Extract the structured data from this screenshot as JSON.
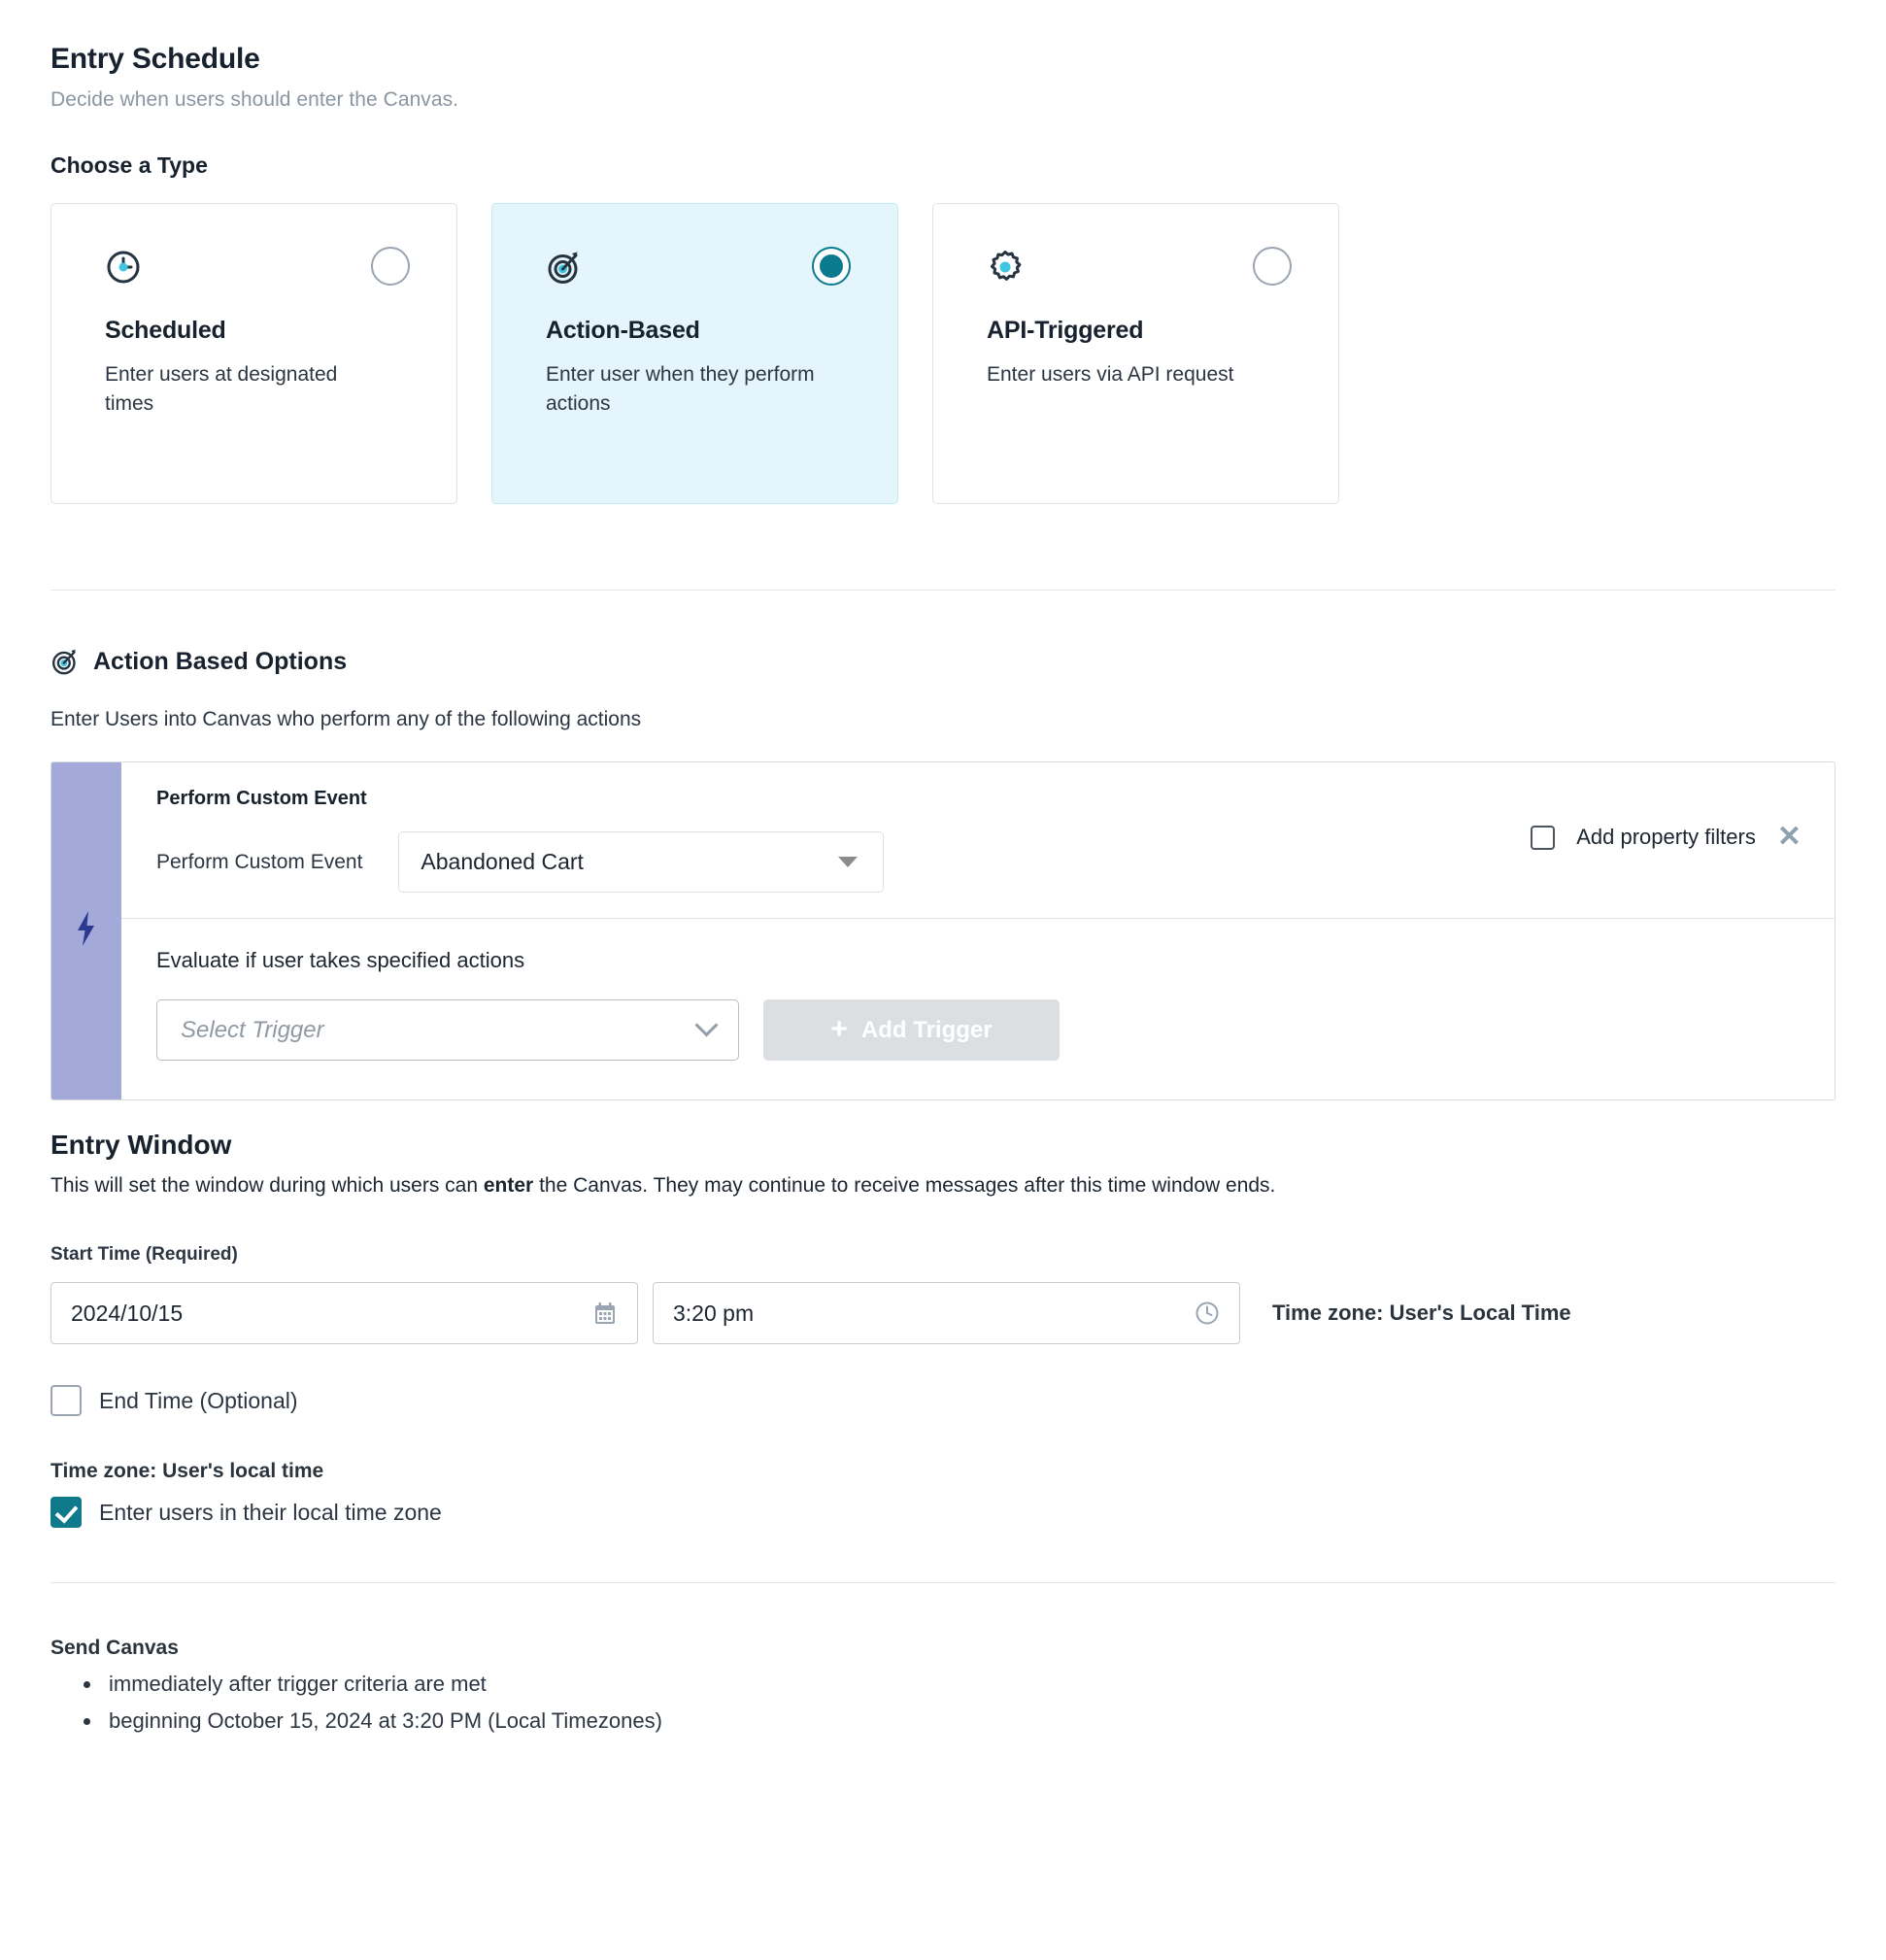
{
  "header": {
    "title": "Entry Schedule",
    "subtitle": "Decide when users should enter the Canvas.",
    "choose_type_label": "Choose a Type"
  },
  "type_cards": [
    {
      "icon": "clock-icon",
      "title": "Scheduled",
      "description": "Enter users at designated times",
      "selected": false
    },
    {
      "icon": "target-icon",
      "title": "Action-Based",
      "description": "Enter user when they perform actions",
      "selected": true
    },
    {
      "icon": "gear-icon",
      "title": "API-Triggered",
      "description": "Enter users via API request",
      "selected": false
    }
  ],
  "action_based": {
    "heading": "Action Based Options",
    "subheading": "Enter Users into Canvas who perform any of the following actions",
    "trigger_card": {
      "title": "Perform Custom Event",
      "row_label": "Perform Custom Event",
      "event_select_value": "Abandoned Cart",
      "property_filters_label": "Add property filters",
      "property_filters_checked": false,
      "remove_icon": "close-icon"
    },
    "evaluate": {
      "text": "Evaluate if user takes specified actions",
      "select_placeholder": "Select Trigger",
      "add_trigger_label": "Add Trigger",
      "add_trigger_disabled": true
    }
  },
  "entry_window": {
    "title": "Entry Window",
    "description_pre": "This will set the window during which users can ",
    "description_bold": "enter",
    "description_post": " the Canvas. They may continue to receive messages after this time window ends.",
    "start_time_label": "Start Time (Required)",
    "start_date_value": "2024/10/15",
    "start_time_value": "3:20 pm",
    "timezone_inline": "Time zone: User's Local Time",
    "end_time_label": "End Time (Optional)",
    "end_time_checked": false,
    "timezone_heading": "Time zone: User's local time",
    "local_timezone_label": "Enter users in their local time zone",
    "local_timezone_checked": true
  },
  "send_canvas": {
    "title": "Send Canvas",
    "items": [
      "immediately after trigger criteria are met",
      "beginning October 15, 2024 at 3:20 PM (Local Timezones)"
    ]
  },
  "colors": {
    "teal": "#0a7a8f",
    "cyan_accent": "#3fc6e0",
    "card_selected_bg": "#e4f6fb",
    "card_selected_border": "#bfe9f3",
    "periwinkle_bar": "#a3a9d9",
    "bolt_navy": "#2b3a8f",
    "text_dark": "#18222e",
    "muted": "#8b96a3"
  }
}
